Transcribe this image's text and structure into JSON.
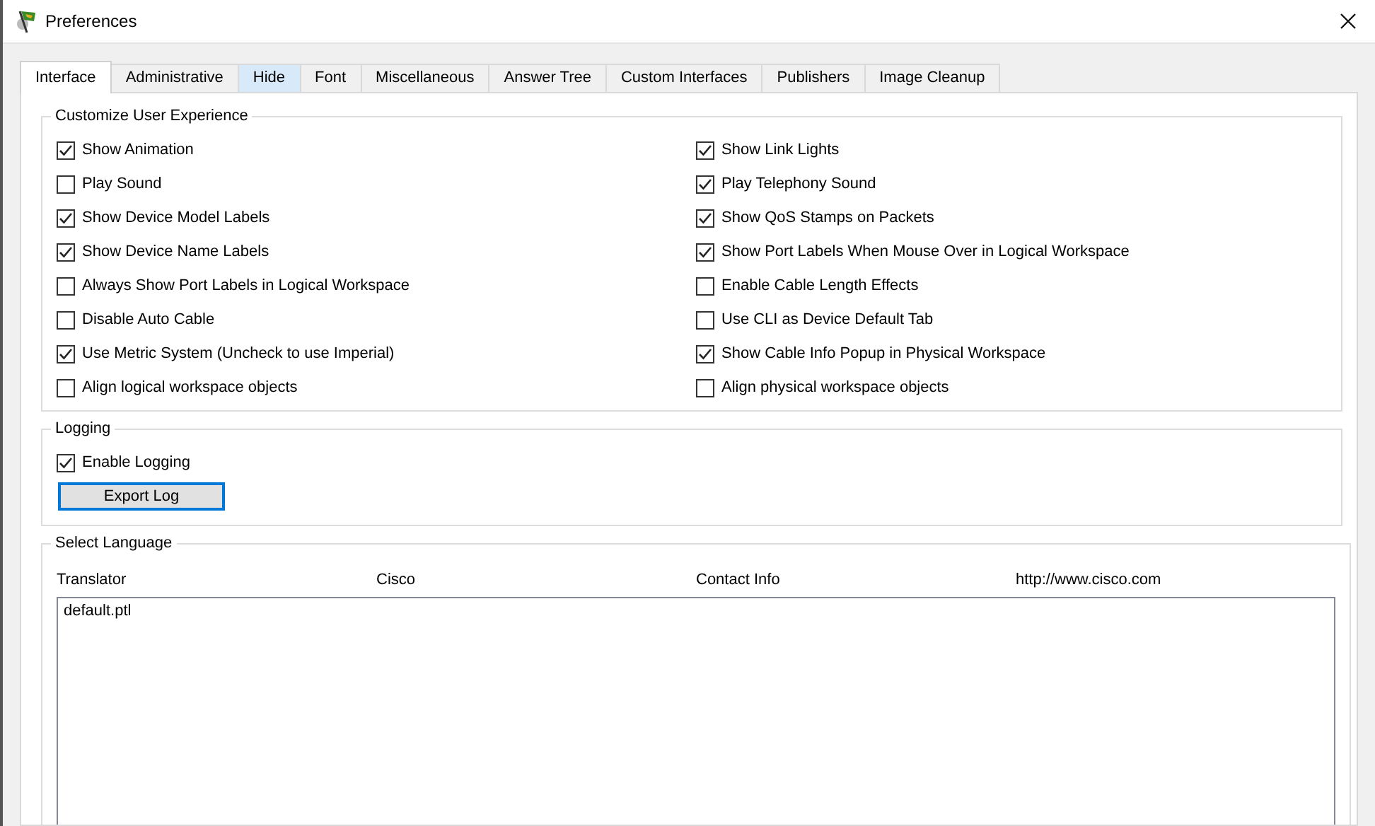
{
  "window": {
    "title": "Preferences"
  },
  "tabs": [
    {
      "label": "Interface",
      "selected": true,
      "hovered": false
    },
    {
      "label": "Administrative",
      "selected": false,
      "hovered": false
    },
    {
      "label": "Hide",
      "selected": false,
      "hovered": true
    },
    {
      "label": "Font",
      "selected": false,
      "hovered": false
    },
    {
      "label": "Miscellaneous",
      "selected": false,
      "hovered": false
    },
    {
      "label": "Answer Tree",
      "selected": false,
      "hovered": false
    },
    {
      "label": "Custom Interfaces",
      "selected": false,
      "hovered": false
    },
    {
      "label": "Publishers",
      "selected": false,
      "hovered": false
    },
    {
      "label": "Image Cleanup",
      "selected": false,
      "hovered": false
    }
  ],
  "customize": {
    "title": "Customize User Experience",
    "options": [
      {
        "label": "Show Animation",
        "checked": true
      },
      {
        "label": "Show Link Lights",
        "checked": true
      },
      {
        "label": "Play Sound",
        "checked": false
      },
      {
        "label": "Play Telephony Sound",
        "checked": true
      },
      {
        "label": "Show Device Model Labels",
        "checked": true
      },
      {
        "label": "Show QoS Stamps on Packets",
        "checked": true
      },
      {
        "label": "Show Device Name Labels",
        "checked": true
      },
      {
        "label": "Show Port Labels When Mouse Over in Logical Workspace",
        "checked": true
      },
      {
        "label": "Always Show Port Labels in Logical Workspace",
        "checked": false
      },
      {
        "label": "Enable Cable Length Effects",
        "checked": false
      },
      {
        "label": "Disable Auto Cable",
        "checked": false
      },
      {
        "label": "Use CLI as Device Default Tab",
        "checked": false
      },
      {
        "label": "Use Metric System (Uncheck to use Imperial)",
        "checked": true
      },
      {
        "label": "Show Cable Info Popup in Physical Workspace",
        "checked": true
      },
      {
        "label": "Align logical workspace objects",
        "checked": false
      },
      {
        "label": "Align physical workspace objects",
        "checked": false
      }
    ]
  },
  "logging": {
    "title": "Logging",
    "enable": {
      "label": "Enable Logging",
      "checked": true
    },
    "button": "Export Log"
  },
  "language": {
    "title": "Select Language",
    "headers": [
      "Translator",
      "Cisco",
      "Contact Info",
      "http://www.cisco.com"
    ],
    "items": [
      "default.ptl"
    ]
  }
}
